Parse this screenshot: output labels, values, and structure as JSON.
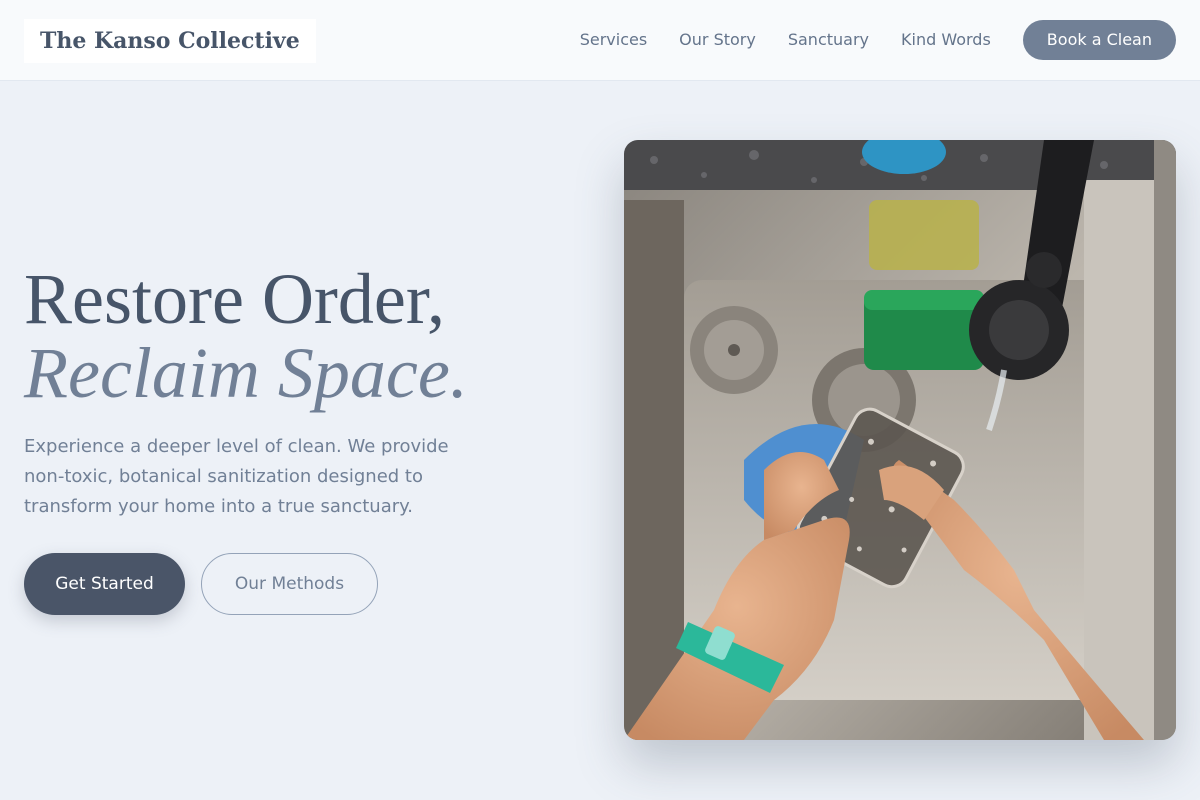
{
  "brand": {
    "name": "The Kanso Collective"
  },
  "nav": {
    "links": [
      "Services",
      "Our Story",
      "Sanctuary",
      "Kind Words"
    ],
    "cta": "Book a Clean"
  },
  "hero": {
    "title_line1": "Restore Order,",
    "title_line2": "Reclaim Space.",
    "description": "Experience a deeper level of clean. We provide non-toxic, botanical sanitization designed to transform your home into a true sanctuary.",
    "primary_button": "Get Started",
    "secondary_button": "Our Methods",
    "image": {
      "subject": "hands washing a glass with a blue sponge over a stainless steel sink"
    }
  },
  "colors": {
    "background": "#edf1f7",
    "header": "#f8fafc",
    "heading": "#475569",
    "accent": "#718096",
    "primary_button": "#4a5568"
  }
}
